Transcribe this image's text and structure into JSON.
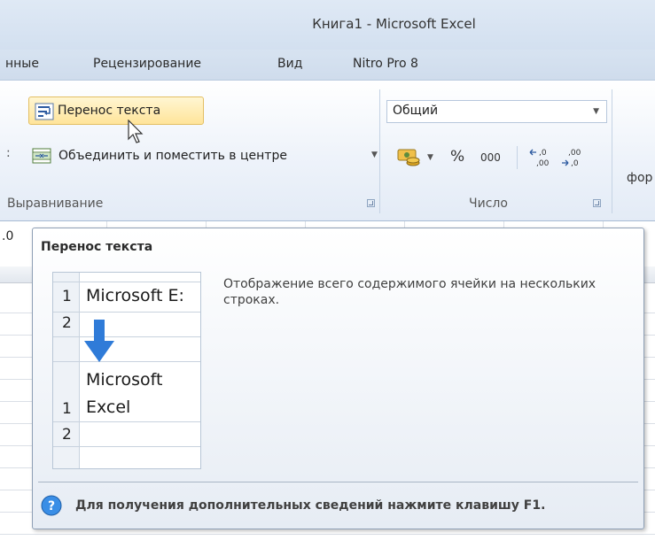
{
  "window": {
    "title": "Книга1  -  Microsoft Excel"
  },
  "tabs": [
    "нные",
    "Рецензирование",
    "Вид",
    "Nitro Pro 8"
  ],
  "alignment_group": {
    "wrap_text_label": "Перенос текста",
    "merge_center_label": "Объединить и поместить в центре",
    "group_label": "Выравнивание"
  },
  "number_group": {
    "format_value": "Общий",
    "percent_label": "%",
    "thousands_label": "000",
    "increase_decimal": ",0 ,00",
    "decrease_decimal": ",00 ,0",
    "group_label": "Число"
  },
  "partial_next_group": "фор",
  "name_box_partial": ".0",
  "tooltip": {
    "title": "Перенос текста",
    "description": "Отображение всего содержимого ячейки на нескольких строках.",
    "preview_before": {
      "row1_num": "1",
      "row1_text": "Microsoft E:",
      "row2_num": "2"
    },
    "preview_after": {
      "row1_num": "1",
      "row1_line1": "Microsoft",
      "row1_line2": "Excel",
      "row2_num": "2"
    },
    "help_text": "Для получения дополнительных сведений нажмите клавишу F1."
  },
  "colors": {
    "accent_blue": "#2f7bd8",
    "highlight_button": "#ffe49a",
    "help_icon": "#3a8ee6"
  }
}
